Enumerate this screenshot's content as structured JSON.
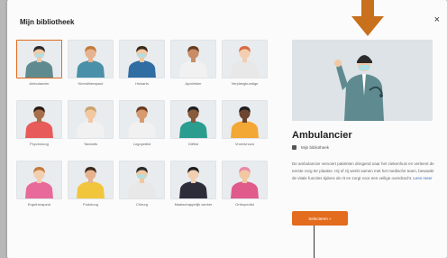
{
  "dialog": {
    "title": "Mijn bibliotheek",
    "close_label": "×"
  },
  "library": {
    "items": [
      {
        "label": "Ambulancier",
        "skin": "#f2c9a6",
        "hair": "#2b2b2b",
        "top": "#5f8b90",
        "mask": true,
        "selected": true
      },
      {
        "label": "Kinesitherapeut",
        "skin": "#e7b38f",
        "hair": "#c47a3a",
        "top": "#4a90a8",
        "mask": false
      },
      {
        "label": "Huisarts",
        "skin": "#f1c8a2",
        "hair": "#3c2a1a",
        "top": "#2f6da3",
        "mask": true
      },
      {
        "label": "Apotheker",
        "skin": "#c98c64",
        "hair": "#6a3d1e",
        "top": "#f1f1f1",
        "mask": false
      },
      {
        "label": "Verpleegkundige",
        "skin": "#f3cfb1",
        "hair": "#d96a45",
        "top": "#e8e8e8",
        "mask": false
      },
      {
        "label": "Psycholoog",
        "skin": "#a8704a",
        "hair": "#2b1d12",
        "top": "#e85b5b",
        "mask": false
      },
      {
        "label": "Tandarts",
        "skin": "#f1c8a2",
        "hair": "#c8a36a",
        "top": "#f1f1f1",
        "mask": false
      },
      {
        "label": "Logopedist",
        "skin": "#d89b70",
        "hair": "#6a3d1e",
        "top": "#f1f1f1",
        "mask": false
      },
      {
        "label": "Diëtist",
        "skin": "#8a5a3c",
        "hair": "#1e1e1e",
        "top": "#2a9d8f",
        "mask": false
      },
      {
        "label": "Vroedvrouw",
        "skin": "#6d4530",
        "hair": "#1e1e1e",
        "top": "#f3a735",
        "mask": false
      },
      {
        "label": "Ergotherapeut",
        "skin": "#f3cfb1",
        "hair": "#c47a3a",
        "top": "#e86a9a",
        "mask": false
      },
      {
        "label": "Podoloog",
        "skin": "#e7b38f",
        "hair": "#3c2a1a",
        "top": "#f2c63c",
        "mask": false
      },
      {
        "label": "Chirurg",
        "skin": "#f1c8a2",
        "hair": "#2b2b2b",
        "top": "#e8e8e8",
        "mask": true
      },
      {
        "label": "Maatschappelijk werker",
        "skin": "#f3cfb1",
        "hair": "#1e1e1e",
        "top": "#2d2d3a",
        "mask": false
      },
      {
        "label": "Orthopedist",
        "skin": "#f1c8a2",
        "hair": "#e88aa5",
        "top": "#e05a8a",
        "mask": false
      }
    ]
  },
  "detail": {
    "title": "Ambulancier",
    "meta": "Mijn bibliotheek",
    "description": "De ambulancier vervoert patiënten dringend naar het ziekenhuis en verleent de eerste zorg ter plaatse. Hij of zij werkt samen met het medische team, bewaakt de vitale functies tijdens de rit en zorgt voor een veilige overdracht.",
    "description_link": "Lees meer",
    "button_label": "Selecteren »"
  },
  "colors": {
    "accent": "#e36c1e",
    "arrow": "#c8701c"
  },
  "icons": {
    "close": "close-icon",
    "meta": "library-icon",
    "annotation": "down-arrow-icon"
  }
}
